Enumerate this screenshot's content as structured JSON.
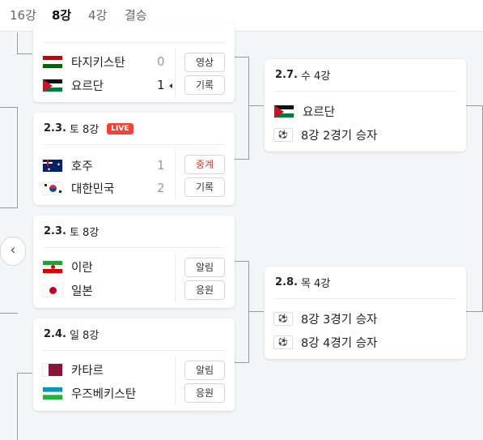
{
  "tabs": [
    "16강",
    "8강",
    "4강",
    "결승"
  ],
  "matches": [
    {
      "teams": [
        {
          "name": "타지키스탄",
          "flag": "tajikistan-flag",
          "score": "0"
        },
        {
          "name": "요르단",
          "flag": "jordan-flag",
          "score": "1"
        }
      ],
      "buttons": [
        "영상",
        "기록"
      ]
    },
    {
      "date": "2.3.",
      "label": "토 8강",
      "live": "LIVE",
      "teams": [
        {
          "name": "호주",
          "flag": "australia-flag",
          "score": "1"
        },
        {
          "name": "대한민국",
          "flag": "korea-flag",
          "score": "2"
        }
      ],
      "buttons": [
        "중계",
        "기록"
      ]
    },
    {
      "date": "2.3.",
      "label": "토 8강",
      "teams": [
        {
          "name": "이란",
          "flag": "iran-flag"
        },
        {
          "name": "일본",
          "flag": "japan-flag"
        }
      ],
      "buttons": [
        "알림",
        "응원"
      ]
    },
    {
      "date": "2.4.",
      "label": "일 8강",
      "teams": [
        {
          "name": "카타르",
          "flag": "qatar-flag"
        },
        {
          "name": "우즈베키스탄",
          "flag": "uzbekistan-flag"
        }
      ],
      "buttons": [
        "알림",
        "응원"
      ]
    }
  ],
  "semis": [
    {
      "date": "2.7.",
      "label": "수 4강",
      "teams": [
        {
          "name": "요르단",
          "icon": "jordan-flag"
        },
        {
          "name": "8강 2경기 승자",
          "icon": "soccer-ball-icon"
        }
      ]
    },
    {
      "date": "2.8.",
      "label": "목 4강",
      "teams": [
        {
          "name": "8강 3경기 승자",
          "icon": "soccer-ball-icon"
        },
        {
          "name": "8강 4경기 승자",
          "icon": "soccer-ball-icon"
        }
      ]
    }
  ],
  "colors": {
    "live": "#f44336",
    "relay_button": "#e53935",
    "bracket_line": "#9a9a9a"
  }
}
